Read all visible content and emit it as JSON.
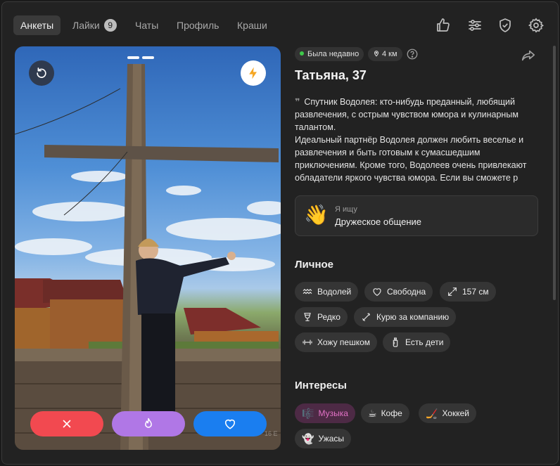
{
  "nav": {
    "tabs": [
      {
        "label": "Анкеты",
        "active": true
      },
      {
        "label": "Лайки",
        "badge": "9"
      },
      {
        "label": "Чаты"
      },
      {
        "label": "Профиль"
      },
      {
        "label": "Краши"
      }
    ],
    "icons": [
      "thumbs-up-icon",
      "sliders-icon",
      "shield-check-icon",
      "gear-icon"
    ]
  },
  "photo": {
    "progress_segments": 2,
    "watermark": "16 E",
    "buttons": {
      "dislike": "close-icon",
      "superlike": "flame-icon",
      "like": "heart-icon"
    },
    "colors": {
      "dislike": "#f24950",
      "superlike": "#b077e6",
      "like": "#1a7ef0",
      "boost": "#f5a623"
    }
  },
  "profile": {
    "status": "Была недавно",
    "distance": "4 км",
    "name": "Татьяна, 37",
    "bio": "Спутник Водолея: кто-нибудь преданный, любящий развлечения, с острым чувством юмора и кулинарным талантом.\nИдеальный партнёр Водолея должен любить веселье и развлечения и быть готовым к сумасшедшим приключениям. Кроме того, Водолеев очень привлекают обладатели яркого чувства юмора. Если вы сможете р",
    "looking_for": {
      "label": "Я ищу",
      "value": "Дружеское общение",
      "emoji": "👋"
    }
  },
  "personal": {
    "title": "Личное",
    "chips": [
      {
        "label": "Водолей",
        "icon": "aquarius-icon"
      },
      {
        "label": "Свободна",
        "icon": "heart-outline-icon"
      },
      {
        "label": "157 см",
        "icon": "expand-icon"
      },
      {
        "label": "Редко",
        "icon": "wine-glass-icon"
      },
      {
        "label": "Курю за компанию",
        "icon": "cigarette-icon"
      },
      {
        "label": "Хожу пешком",
        "icon": "dumbbell-icon"
      },
      {
        "label": "Есть дети",
        "icon": "baby-bottle-icon"
      }
    ]
  },
  "interests": {
    "title": "Интересы",
    "chips": [
      {
        "label": "Музыка",
        "emoji": "🎼",
        "highlighted": true
      },
      {
        "label": "Кофе",
        "emoji": "☕"
      },
      {
        "label": "Хоккей",
        "emoji": "🏒"
      },
      {
        "label": "Ужасы",
        "emoji": "👻"
      }
    ]
  }
}
